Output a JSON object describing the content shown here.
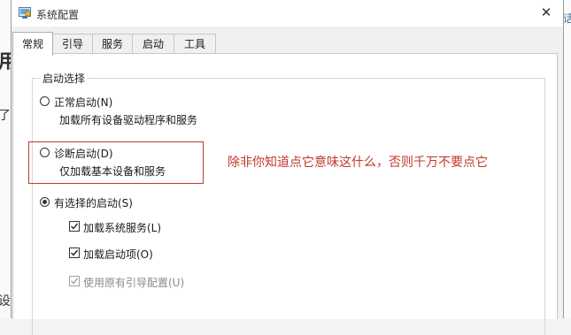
{
  "window": {
    "title": "系统配置",
    "close_glyph": "✕"
  },
  "tabs": [
    {
      "label": "常规",
      "active": true
    },
    {
      "label": "引导",
      "active": false
    },
    {
      "label": "服务",
      "active": false
    },
    {
      "label": "启动",
      "active": false
    },
    {
      "label": "工具",
      "active": false
    }
  ],
  "startup_group": {
    "title": "启动选择",
    "options": [
      {
        "label": "正常启动(N)",
        "description": "加载所有设备驱动程序和服务",
        "selected": false
      },
      {
        "label": "诊断启动(D)",
        "description": "仅加载基本设备和服务",
        "selected": false
      },
      {
        "label": "有选择的启动(S)",
        "description": "",
        "selected": true
      }
    ],
    "checkboxes": [
      {
        "label": "加载系统服务(L)",
        "checked": true,
        "disabled": false
      },
      {
        "label": "加载启动项(O)",
        "checked": true,
        "disabled": false
      },
      {
        "label": "使用原有引导配置(U)",
        "checked": true,
        "disabled": true
      }
    ]
  },
  "annotation": {
    "text": "除非你知道点它意味这什么，否则千万不要点它",
    "color": "#c0392b"
  },
  "background": {
    "left_chars": [
      "用",
      "了",
      "设"
    ],
    "right_chars": [
      "话"
    ]
  }
}
